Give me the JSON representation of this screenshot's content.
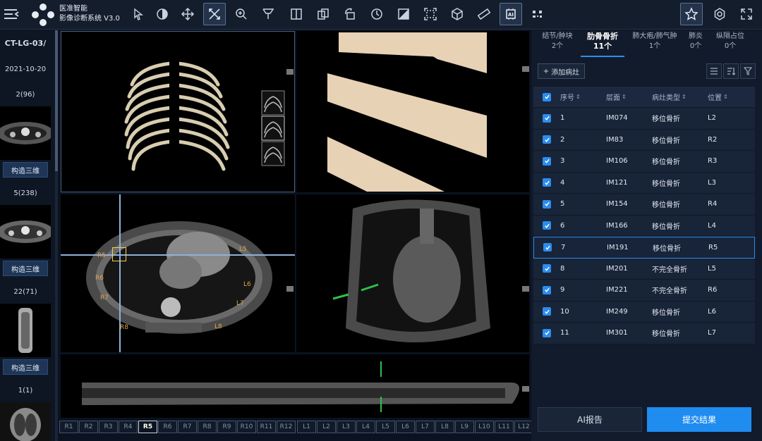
{
  "app": {
    "name_line1": "医准智能",
    "name_line2": "影像诊断系统 V3.0"
  },
  "toolbar": {
    "tools": [
      {
        "name": "select-tool",
        "active": false
      },
      {
        "name": "window-level-tool",
        "active": false
      },
      {
        "name": "pan-tool",
        "active": false
      },
      {
        "name": "crosshair-tool",
        "active": true
      },
      {
        "name": "zoom-tool",
        "active": false
      },
      {
        "name": "probe-tool",
        "active": false
      },
      {
        "name": "layout-tool",
        "active": false
      },
      {
        "name": "sync-tool",
        "active": false
      },
      {
        "name": "rotate-tool",
        "active": false
      },
      {
        "name": "history-tool",
        "active": false
      },
      {
        "name": "invert-tool",
        "active": false
      },
      {
        "name": "fit-tool",
        "active": false
      },
      {
        "name": "3d-cube-tool",
        "active": false
      },
      {
        "name": "ruler-tool",
        "active": false
      },
      {
        "name": "ai-tool",
        "active": true
      },
      {
        "name": "qr-tool",
        "active": false
      }
    ],
    "right_tools": [
      "star-icon",
      "gear-icon",
      "fullscreen-icon"
    ]
  },
  "sidebar": {
    "study_id": "CT-LG-03/",
    "date": "2021-10-20",
    "series": [
      {
        "label": "2(96)",
        "button": "构造三维"
      },
      {
        "label": "5(238)",
        "button": "构造三维"
      },
      {
        "label": "22(71)",
        "button": "构造三维"
      },
      {
        "label": "1(1)",
        "button": ""
      }
    ]
  },
  "viewport": {
    "labels_left": [
      "R5",
      "R6",
      "R7",
      "R8"
    ],
    "labels_right": [
      "L5",
      "L6",
      "L7",
      "L8"
    ],
    "ruler_r": [
      "R1",
      "R2",
      "R3",
      "R4",
      "R5",
      "R6",
      "R7",
      "R8",
      "R9",
      "R10",
      "R11",
      "R12"
    ],
    "ruler_l": [
      "L1",
      "L2",
      "L3",
      "L4",
      "L5",
      "L6",
      "L7",
      "L8",
      "L9",
      "L10",
      "L11",
      "L12"
    ],
    "ruler_active": "R5"
  },
  "panel": {
    "categories": [
      {
        "label": "结节/肿块",
        "count": "2个"
      },
      {
        "label": "肋骨骨折",
        "count": "11个",
        "active": true
      },
      {
        "label": "肺大疱/肺气肿",
        "count": "1个"
      },
      {
        "label": "肺炎",
        "count": "0个"
      },
      {
        "label": "纵隔占位",
        "count": "0个"
      }
    ],
    "add_label": "添加病灶",
    "columns": [
      "序号",
      "层面",
      "病灶类型",
      "位置"
    ],
    "rows": [
      {
        "no": "1",
        "layer": "IM074",
        "type": "移位骨折",
        "pos": "L2"
      },
      {
        "no": "2",
        "layer": "IM83",
        "type": "移位骨折",
        "pos": "R2"
      },
      {
        "no": "3",
        "layer": "IM106",
        "type": "移位骨折",
        "pos": "R3"
      },
      {
        "no": "4",
        "layer": "IM121",
        "type": "移位骨折",
        "pos": "L3"
      },
      {
        "no": "5",
        "layer": "IM154",
        "type": "移位骨折",
        "pos": "R4"
      },
      {
        "no": "6",
        "layer": "IM166",
        "type": "移位骨折",
        "pos": "L4"
      },
      {
        "no": "7",
        "layer": "IM191",
        "type": "移位骨折",
        "pos": "R5",
        "selected": true
      },
      {
        "no": "8",
        "layer": "IM201",
        "type": "不完全骨折",
        "pos": "L5"
      },
      {
        "no": "9",
        "layer": "IM221",
        "type": "不完全骨折",
        "pos": "R6"
      },
      {
        "no": "10",
        "layer": "IM249",
        "type": "移位骨折",
        "pos": "L6"
      },
      {
        "no": "11",
        "layer": "IM301",
        "type": "移位骨折",
        "pos": "L7"
      }
    ],
    "ai_report": "AI报告",
    "submit": "提交结果"
  },
  "colors": {
    "accent": "#2d8cf0",
    "annotation": "#e1a54b",
    "crosshair": "#8fb0d8"
  }
}
